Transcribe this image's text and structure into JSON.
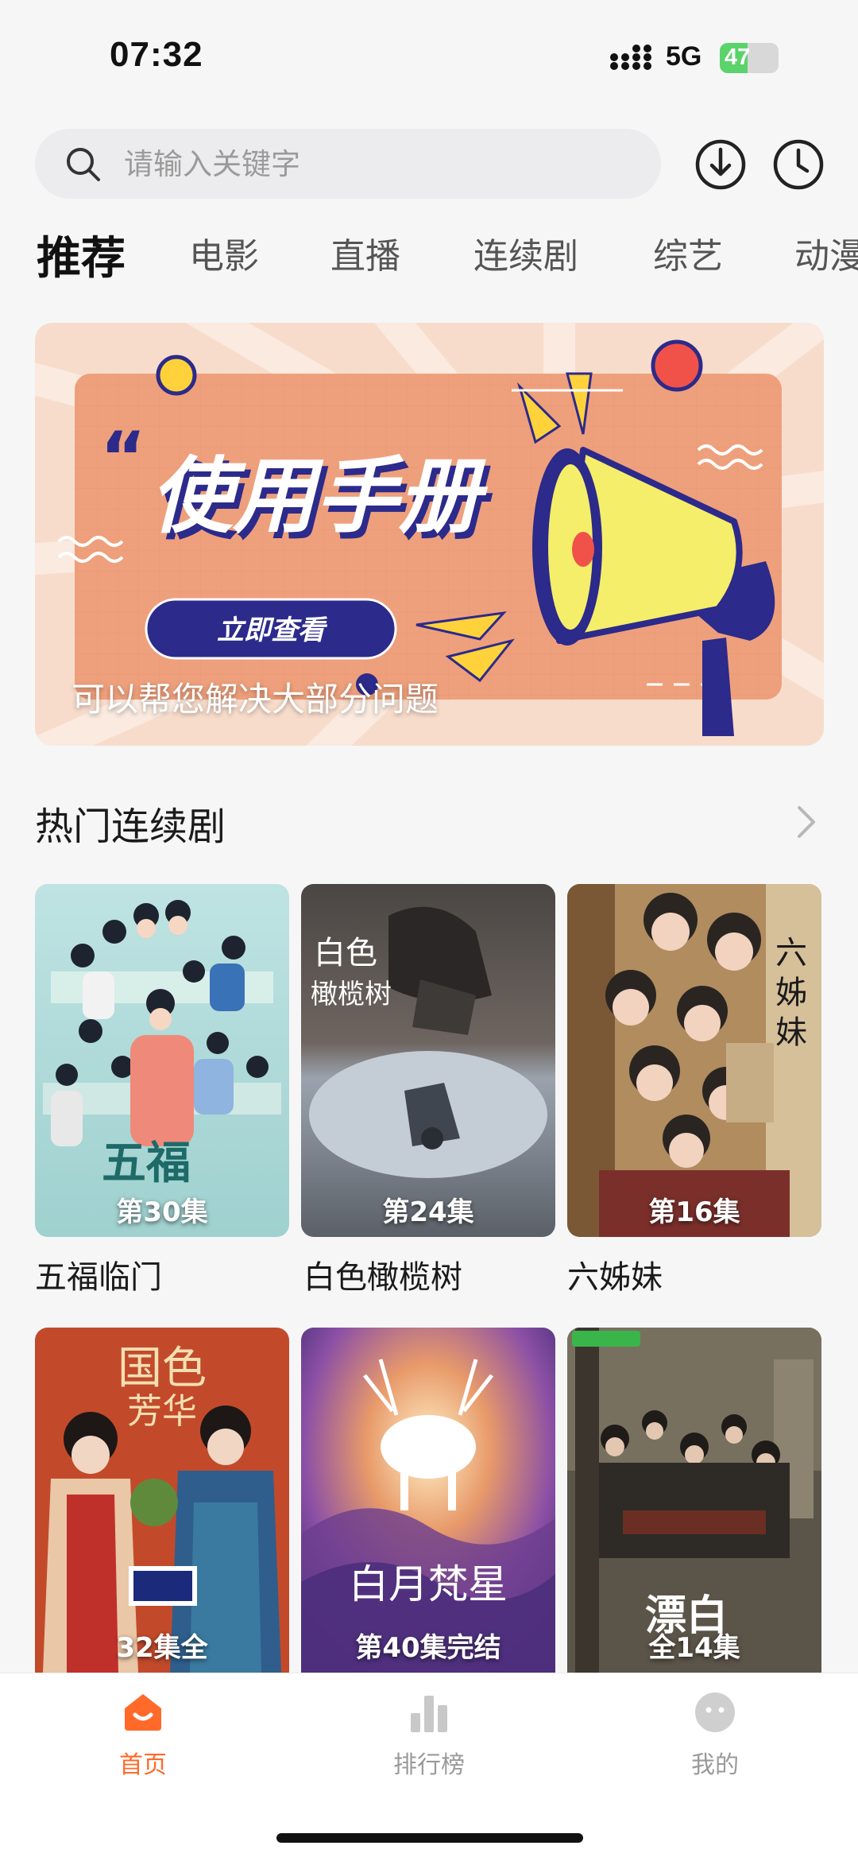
{
  "status_bar": {
    "time": "07:32",
    "network": "5G",
    "battery": "47",
    "battery_level": 0.47
  },
  "search": {
    "placeholder": "请输入关键字"
  },
  "tabs": [
    "推荐",
    "电影",
    "直播",
    "连续剧",
    "综艺",
    "动漫"
  ],
  "banner": {
    "headline": "使用手册",
    "button_label": "立即查看",
    "caption": "可以帮您解决大部分问题"
  },
  "section": {
    "title": "热门连续剧"
  },
  "shows": [
    {
      "title": "五福临门",
      "episode_label": "第30集"
    },
    {
      "title": "白色橄榄树",
      "episode_label": "第24集"
    },
    {
      "title": "六姊妹",
      "episode_label": "第16集"
    },
    {
      "title": "",
      "episode_label": "32集全"
    },
    {
      "title": "",
      "episode_label": "第40集完结"
    },
    {
      "title": "",
      "episode_label": "全14集"
    }
  ],
  "bottom_nav": [
    {
      "label": "首页",
      "icon": "home-icon",
      "active": true
    },
    {
      "label": "排行榜",
      "icon": "ranking-icon",
      "active": false
    },
    {
      "label": "我的",
      "icon": "profile-icon",
      "active": false
    }
  ],
  "colors": {
    "accent": "#ff6a2a",
    "battery": "#5bd36b",
    "banner_bg": "#f7d3bd"
  }
}
